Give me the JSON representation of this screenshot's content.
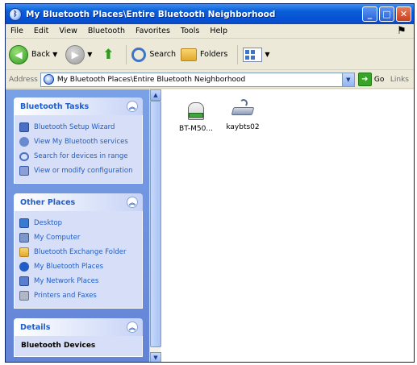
{
  "window": {
    "title": "My Bluetooth Places\\Entire Bluetooth Neighborhood"
  },
  "menu": [
    "File",
    "Edit",
    "View",
    "Bluetooth",
    "Favorites",
    "Tools",
    "Help"
  ],
  "toolbar": {
    "back_label": "Back",
    "search_label": "Search",
    "folders_label": "Folders"
  },
  "address": {
    "label": "Address",
    "value": "My Bluetooth Places\\Entire Bluetooth Neighborhood",
    "go_label": "Go",
    "links_label": "Links"
  },
  "taskpane": {
    "bluetooth_tasks": {
      "title": "Bluetooth Tasks",
      "items": [
        "Bluetooth Setup Wizard",
        "View My Bluetooth services",
        "Search for devices in range",
        "View or modify configuration"
      ]
    },
    "other_places": {
      "title": "Other Places",
      "items": [
        "Desktop",
        "My Computer",
        "Bluetooth Exchange Folder",
        "My Bluetooth Places",
        "My Network Places",
        "Printers and Faxes"
      ]
    },
    "details": {
      "title": "Details",
      "text": "Bluetooth Devices"
    }
  },
  "files": [
    {
      "label": "BT-M50...",
      "icon": "bluetooth-device-icon"
    },
    {
      "label": "kaybts02",
      "icon": "keyboard-device-icon"
    }
  ]
}
